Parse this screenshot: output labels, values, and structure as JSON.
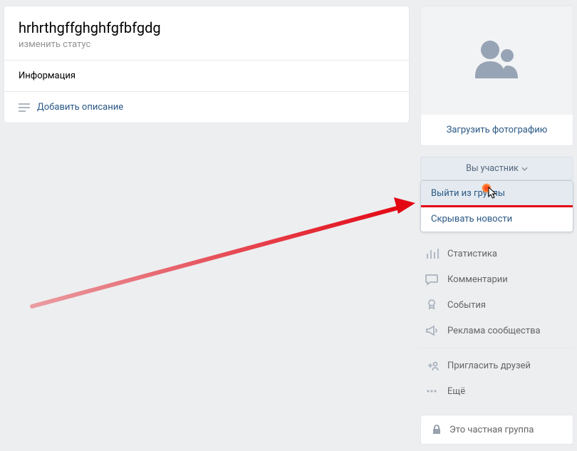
{
  "header": {
    "title": "hrhrthgffghghfgfbfgdg",
    "status": "изменить статус",
    "info_label": "Информация",
    "add_desc": "Добавить описание"
  },
  "sidebar": {
    "upload_photo": "Загрузить фотографию",
    "member_button": "Вы участник",
    "dropdown": {
      "leave": "Выйти из группы",
      "hide_news": "Скрывать новости"
    },
    "menu": {
      "stats": "Статистика",
      "comments": "Комментарии",
      "events": "События",
      "ads": "Реклама сообщества",
      "invite": "Пригласить друзей",
      "more": "Ещё"
    },
    "private_group": "Это частная группа"
  }
}
